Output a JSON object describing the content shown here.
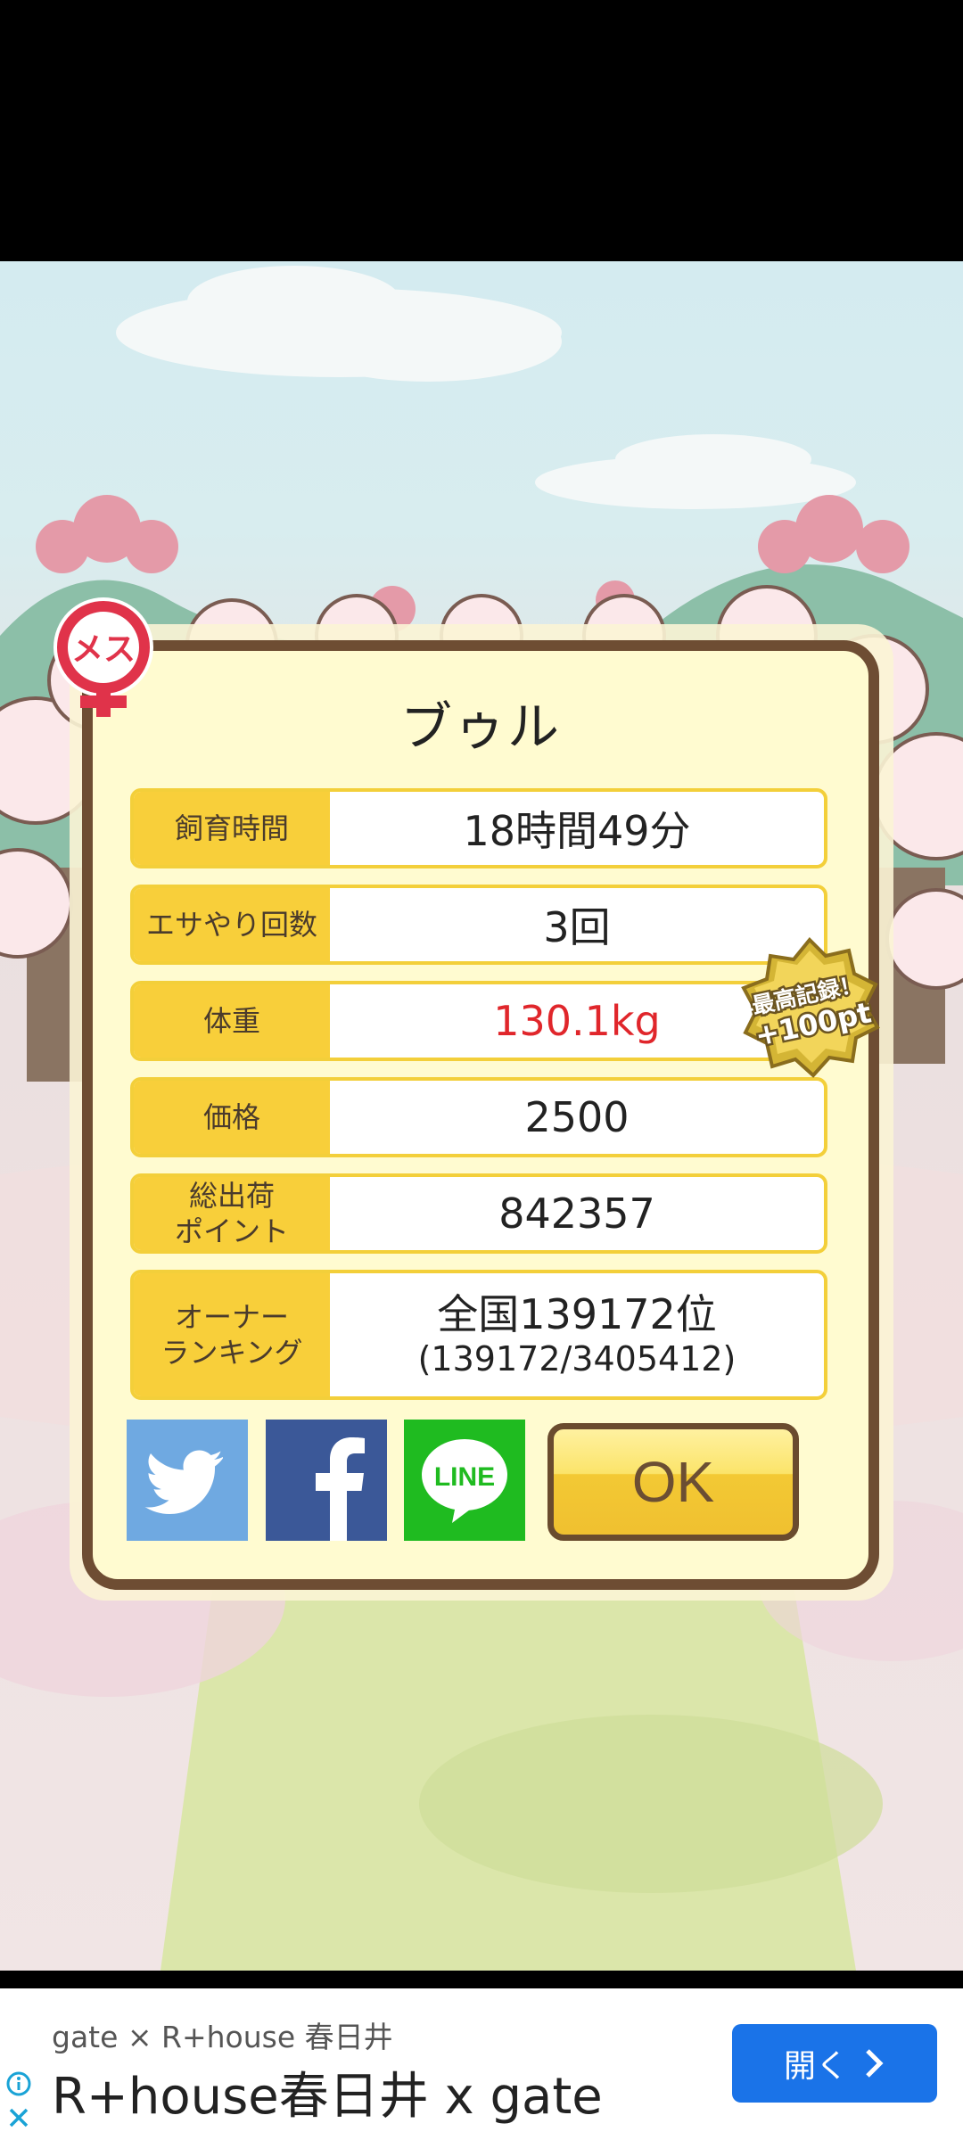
{
  "pet": {
    "name": "ブゥル",
    "gender_label": "メス"
  },
  "stats": {
    "feeding_time": {
      "label": "飼育時間",
      "value": "18時間49分"
    },
    "feed_count": {
      "label": "エサやり回数",
      "value": "3回"
    },
    "weight": {
      "label": "体重",
      "value": "130.1kg"
    },
    "price": {
      "label": "価格",
      "value": "2500"
    },
    "total_points": {
      "label_line1": "総出荷",
      "label_line2": "ポイント",
      "value": "842357"
    },
    "ranking": {
      "label_line1": "オーナー",
      "label_line2": "ランキング",
      "value": "全国139172位",
      "detail": "(139172/3405412)"
    }
  },
  "record_badge": {
    "line1": "最高記録！",
    "line2": "+100pt"
  },
  "share": {
    "twitter_icon": "twitter-bird-icon",
    "facebook_icon": "facebook-f-icon",
    "line_icon": "line-logo-icon",
    "line_text": "LINE"
  },
  "ok_label": "OK",
  "ad": {
    "subline": "gate × R+house 春日井",
    "headline": "R+house春日井 x gate",
    "open_label": "開く",
    "info_icon": "info-icon",
    "close_icon": "close-icon"
  },
  "colors": {
    "label_bg": "#f8cf3a",
    "dialog_bg": "#fffbd0",
    "dialog_border": "#6e4d33",
    "weight_red": "#e0262b",
    "ad_button": "#1a73e8"
  }
}
